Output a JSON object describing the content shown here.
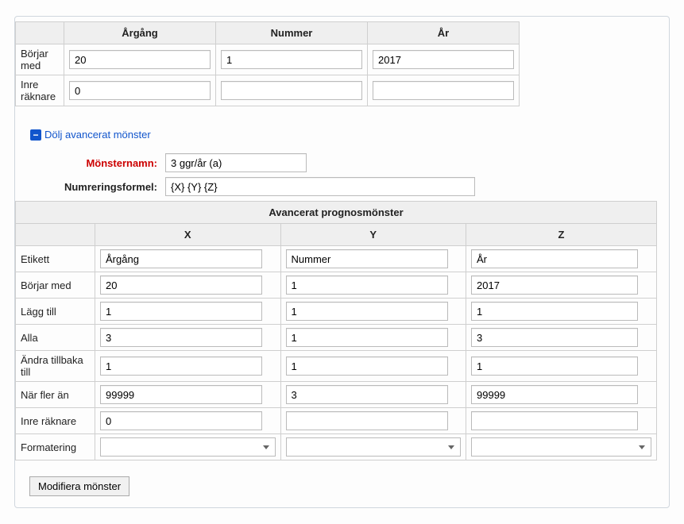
{
  "top_table": {
    "headers": {
      "col1": "Årgång",
      "col2": "Nummer",
      "col3": "År"
    },
    "rows": {
      "begins_with": {
        "label": "Börjar med",
        "col1": "20",
        "col2": "1",
        "col3": "2017"
      },
      "inner_counter": {
        "label": "Inre räknare",
        "col1": "0",
        "col2": "",
        "col3": ""
      }
    }
  },
  "toggle": {
    "label": "Dölj avancerat mönster"
  },
  "fields": {
    "pattern_name": {
      "label": "Mönsternamn:",
      "value": "3 ggr/år (a)"
    },
    "formula": {
      "label": "Numreringsformel:",
      "value": "{X} {Y} {Z}"
    }
  },
  "adv_table": {
    "caption": "Avancerat prognosmönster",
    "headers": {
      "x": "X",
      "y": "Y",
      "z": "Z"
    },
    "rows": {
      "label": {
        "label": "Etikett",
        "x": "Årgång",
        "y": "Nummer",
        "z": "År"
      },
      "begins_with": {
        "label": "Börjar med",
        "x": "20",
        "y": "1",
        "z": "2017"
      },
      "add": {
        "label": "Lägg till",
        "x": "1",
        "y": "1",
        "z": "1"
      },
      "all": {
        "label": "Alla",
        "x": "3",
        "y": "1",
        "z": "3"
      },
      "reset": {
        "label": "Ändra tillbaka till",
        "x": "1",
        "y": "1",
        "z": "1"
      },
      "when_more": {
        "label": "När fler än",
        "x": "99999",
        "y": "3",
        "z": "99999"
      },
      "inner_counter": {
        "label": "Inre räknare",
        "x": "0",
        "y": "",
        "z": ""
      },
      "formatting": {
        "label": "Formatering",
        "x": "",
        "y": "",
        "z": ""
      }
    }
  },
  "buttons": {
    "modify": "Modifiera mönster"
  }
}
